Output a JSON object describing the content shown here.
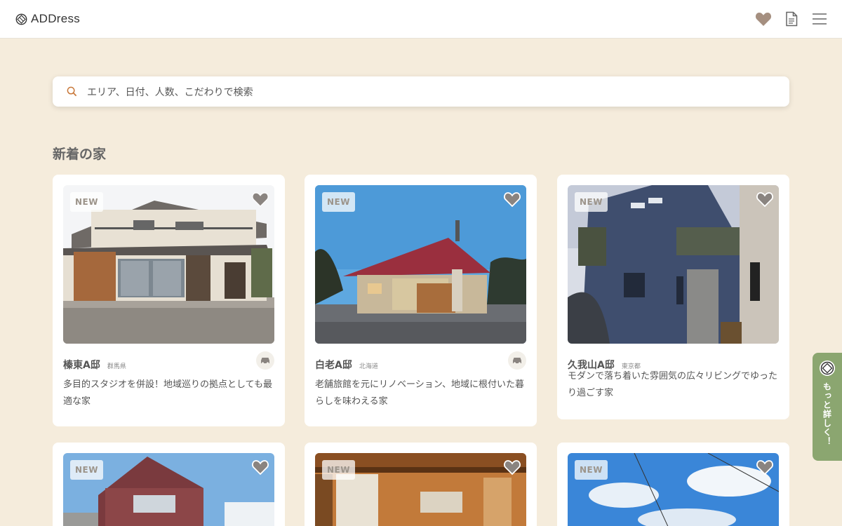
{
  "header": {
    "logo_text": "ADDress",
    "icons": [
      "heart-icon",
      "document-icon",
      "menu-icon"
    ]
  },
  "search": {
    "placeholder": "エリア、日付、人数、こだわりで検索"
  },
  "section": {
    "title": "新着の家"
  },
  "cards": [
    {
      "badge": "NEW",
      "name": "榛東A邸",
      "pref": "群馬県",
      "desc": "多目的スタジオを併設！地域巡りの拠点としても最適な家",
      "car": true
    },
    {
      "badge": "NEW",
      "name": "白老A邸",
      "pref": "北海道",
      "desc": "老舗旅館を元にリノベーション、地域に根付いた暮らしを味わえる家",
      "car": true
    },
    {
      "badge": "NEW",
      "name": "久我山A邸",
      "pref": "東京都",
      "desc": "モダンで落ち着いた雰囲気の広々リビングでゆったり過ごす家",
      "car": false
    },
    {
      "badge": "NEW"
    },
    {
      "badge": "NEW"
    },
    {
      "badge": "NEW"
    }
  ],
  "side_tab": {
    "label": "もっと詳しく！"
  },
  "colors": {
    "background": "#f5ecdc",
    "accent_green": "#8ba670",
    "heart_brown": "#a58f80"
  }
}
